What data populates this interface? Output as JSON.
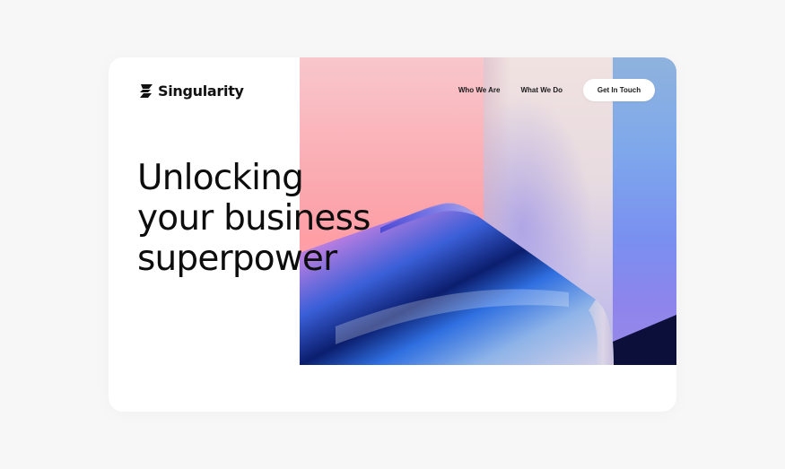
{
  "brand": {
    "name": "Singularity",
    "icon": "lightning-s-logo-icon"
  },
  "nav": {
    "items": [
      {
        "label": "Who We Are"
      },
      {
        "label": "What We Do"
      }
    ],
    "cta_label": "Get In Touch"
  },
  "hero": {
    "headline_lines": [
      "Unlocking",
      "your business",
      "superpower"
    ]
  },
  "colors": {
    "background": "#f7f7f8",
    "card": "#ffffff",
    "text": "#0d0d0d",
    "art_pink": "#fba6ad",
    "art_blue": "#7ea8ec",
    "art_dark": "#0c0f3a"
  }
}
